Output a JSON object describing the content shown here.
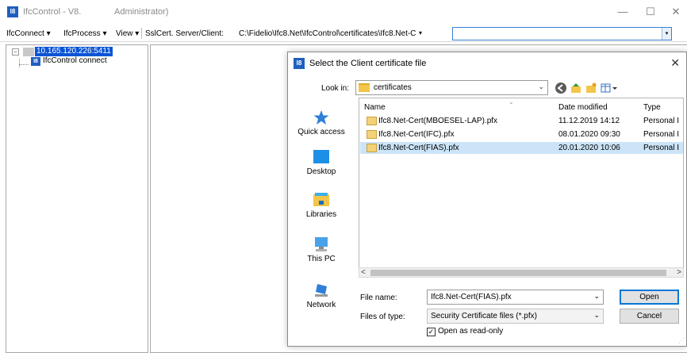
{
  "window": {
    "icon_text": "I8",
    "title": "IfcControl - V8.",
    "admin_suffix": "Administrator)",
    "minimize": "—",
    "maximize": "☐",
    "close": "✕"
  },
  "toolbar": {
    "menus": [
      "IfcConnect ▾",
      "IfcProcess ▾",
      "View ▾"
    ],
    "ssl_label": "SslCert. Server/Client:",
    "ssl_path": "C:\\Fidelio\\Ifc8.Net\\IfcControl\\certificates\\Ifc8.Net-C",
    "dropdown_caret": "▾",
    "combo_caret": "▾",
    "combo_value": ""
  },
  "tree": {
    "root_label": "10.165.120.226:5411",
    "expander": "−",
    "child_icon_text": "I8",
    "child_label": "IfcControl connect"
  },
  "dialog": {
    "icon_text": "I8",
    "title": "Select the Client certificate file",
    "close": "✕",
    "look_in_label": "Look in:",
    "look_in_value": "certificates",
    "look_in_caret": "⌄",
    "places": [
      "Quick access",
      "Desktop",
      "Libraries",
      "This PC",
      "Network"
    ],
    "columns": {
      "name": "Name",
      "date": "Date modified",
      "type": "Type",
      "sort_caret": "⌄"
    },
    "files": [
      {
        "name": "Ifc8.Net-Cert(MBOESEL-LAP).pfx",
        "date": "11.12.2019 14:12",
        "type": "Personal I",
        "selected": false
      },
      {
        "name": "Ifc8.Net-Cert(IFC).pfx",
        "date": "08.01.2020 09:30",
        "type": "Personal I",
        "selected": false
      },
      {
        "name": "Ifc8.Net-Cert(FIAS).pfx",
        "date": "20.01.2020 10:06",
        "type": "Personal I",
        "selected": true
      }
    ],
    "scroll_left": "<",
    "scroll_right": ">",
    "file_name_label": "File name:",
    "file_name_value": "Ifc8.Net-Cert(FIAS).pfx",
    "files_of_type_label": "Files of type:",
    "files_of_type_value": "Security Certificate files (*.pfx)",
    "combo_caret": "⌄",
    "open_button": "Open",
    "cancel_button": "Cancel",
    "read_only_label": "Open as read-only",
    "read_only_checked": true,
    "checkmark": "✓",
    "grip": "⋰"
  },
  "colors": {
    "selection": "#0a54d6",
    "file_selected": "#cce4f7",
    "accent": "#0078d7",
    "app_icon": "#1f5fbf"
  }
}
